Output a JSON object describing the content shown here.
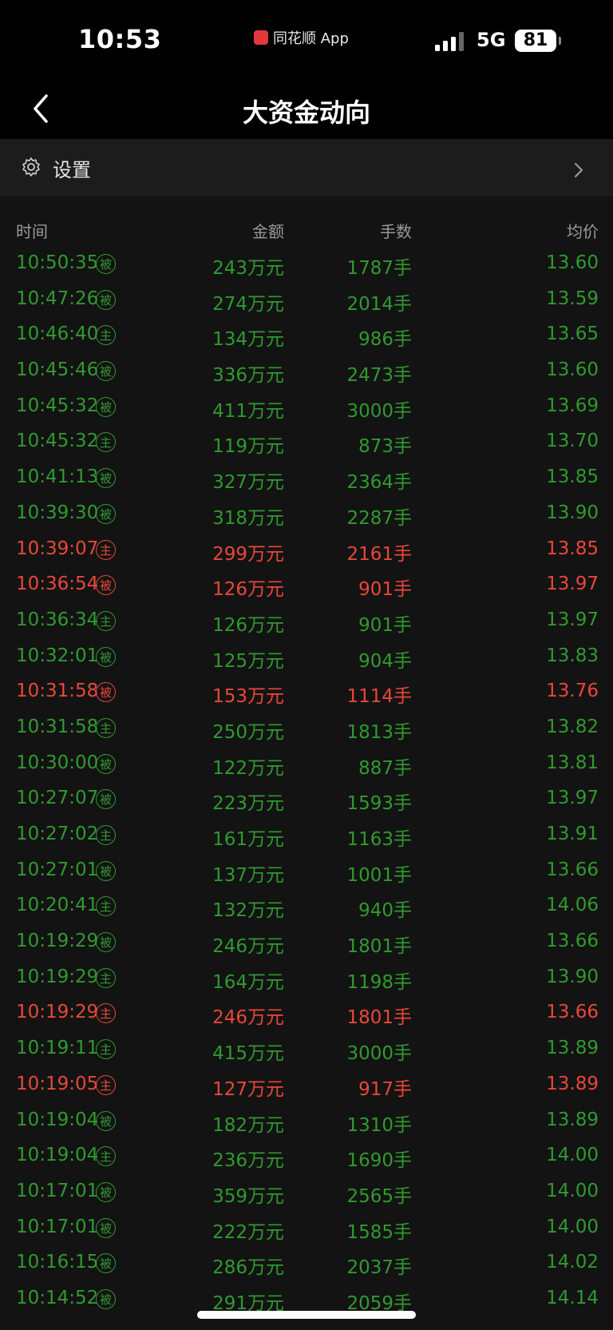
{
  "status_bar": {
    "time": "10:53",
    "app_name": "同花顺 App",
    "network": "5G",
    "battery": "81"
  },
  "nav": {
    "title": "大资金动向"
  },
  "settings": {
    "label": "设置"
  },
  "table": {
    "headers": {
      "time": "时间",
      "amount": "金额",
      "lots": "手数",
      "avg_price": "均价"
    },
    "colors": {
      "green": "#2f9a2f",
      "red": "#e8473a"
    },
    "rows": [
      {
        "time": "10:50:35",
        "tag": "被",
        "amount": "243万元",
        "lots": "1787手",
        "avg": "13.60",
        "color": "green"
      },
      {
        "time": "10:47:26",
        "tag": "被",
        "amount": "274万元",
        "lots": "2014手",
        "avg": "13.59",
        "color": "green"
      },
      {
        "time": "10:46:40",
        "tag": "主",
        "amount": "134万元",
        "lots": "986手",
        "avg": "13.65",
        "color": "green"
      },
      {
        "time": "10:45:46",
        "tag": "被",
        "amount": "336万元",
        "lots": "2473手",
        "avg": "13.60",
        "color": "green"
      },
      {
        "time": "10:45:32",
        "tag": "被",
        "amount": "411万元",
        "lots": "3000手",
        "avg": "13.69",
        "color": "green"
      },
      {
        "time": "10:45:32",
        "tag": "主",
        "amount": "119万元",
        "lots": "873手",
        "avg": "13.70",
        "color": "green"
      },
      {
        "time": "10:41:13",
        "tag": "被",
        "amount": "327万元",
        "lots": "2364手",
        "avg": "13.85",
        "color": "green"
      },
      {
        "time": "10:39:30",
        "tag": "被",
        "amount": "318万元",
        "lots": "2287手",
        "avg": "13.90",
        "color": "green"
      },
      {
        "time": "10:39:07",
        "tag": "主",
        "amount": "299万元",
        "lots": "2161手",
        "avg": "13.85",
        "color": "red"
      },
      {
        "time": "10:36:54",
        "tag": "被",
        "amount": "126万元",
        "lots": "901手",
        "avg": "13.97",
        "color": "red"
      },
      {
        "time": "10:36:34",
        "tag": "主",
        "amount": "126万元",
        "lots": "901手",
        "avg": "13.97",
        "color": "green"
      },
      {
        "time": "10:32:01",
        "tag": "被",
        "amount": "125万元",
        "lots": "904手",
        "avg": "13.83",
        "color": "green"
      },
      {
        "time": "10:31:58",
        "tag": "被",
        "amount": "153万元",
        "lots": "1114手",
        "avg": "13.76",
        "color": "red"
      },
      {
        "time": "10:31:58",
        "tag": "主",
        "amount": "250万元",
        "lots": "1813手",
        "avg": "13.82",
        "color": "green"
      },
      {
        "time": "10:30:00",
        "tag": "被",
        "amount": "122万元",
        "lots": "887手",
        "avg": "13.81",
        "color": "green"
      },
      {
        "time": "10:27:07",
        "tag": "被",
        "amount": "223万元",
        "lots": "1593手",
        "avg": "13.97",
        "color": "green"
      },
      {
        "time": "10:27:02",
        "tag": "主",
        "amount": "161万元",
        "lots": "1163手",
        "avg": "13.91",
        "color": "green"
      },
      {
        "time": "10:27:01",
        "tag": "被",
        "amount": "137万元",
        "lots": "1001手",
        "avg": "13.66",
        "color": "green"
      },
      {
        "time": "10:20:41",
        "tag": "主",
        "amount": "132万元",
        "lots": "940手",
        "avg": "14.06",
        "color": "green"
      },
      {
        "time": "10:19:29",
        "tag": "被",
        "amount": "246万元",
        "lots": "1801手",
        "avg": "13.66",
        "color": "green"
      },
      {
        "time": "10:19:29",
        "tag": "主",
        "amount": "164万元",
        "lots": "1198手",
        "avg": "13.90",
        "color": "green"
      },
      {
        "time": "10:19:29",
        "tag": "主",
        "amount": "246万元",
        "lots": "1801手",
        "avg": "13.66",
        "color": "red"
      },
      {
        "time": "10:19:11",
        "tag": "主",
        "amount": "415万元",
        "lots": "3000手",
        "avg": "13.89",
        "color": "green"
      },
      {
        "time": "10:19:05",
        "tag": "主",
        "amount": "127万元",
        "lots": "917手",
        "avg": "13.89",
        "color": "red"
      },
      {
        "time": "10:19:04",
        "tag": "被",
        "amount": "182万元",
        "lots": "1310手",
        "avg": "13.89",
        "color": "green"
      },
      {
        "time": "10:19:04",
        "tag": "主",
        "amount": "236万元",
        "lots": "1690手",
        "avg": "14.00",
        "color": "green"
      },
      {
        "time": "10:17:01",
        "tag": "被",
        "amount": "359万元",
        "lots": "2565手",
        "avg": "14.00",
        "color": "green"
      },
      {
        "time": "10:17:01",
        "tag": "被",
        "amount": "222万元",
        "lots": "1585手",
        "avg": "14.00",
        "color": "green"
      },
      {
        "time": "10:16:15",
        "tag": "被",
        "amount": "286万元",
        "lots": "2037手",
        "avg": "14.02",
        "color": "green"
      },
      {
        "time": "10:14:52",
        "tag": "被",
        "amount": "291万元",
        "lots": "2059手",
        "avg": "14.14",
        "color": "green"
      }
    ]
  }
}
